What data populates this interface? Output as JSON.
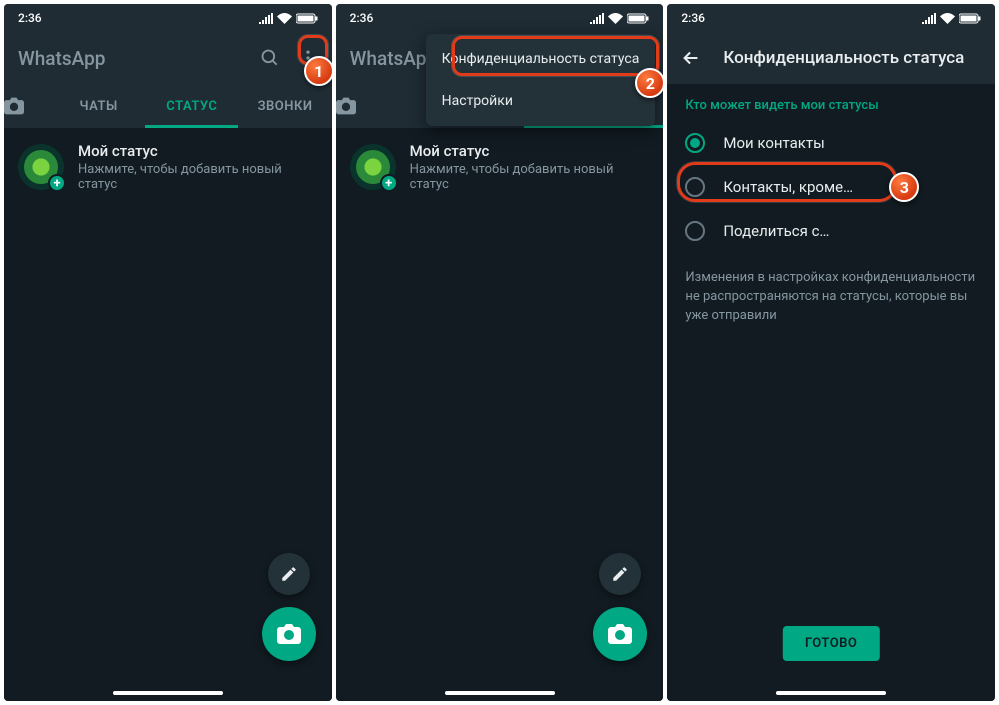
{
  "status_bar": {
    "time": "2:36"
  },
  "app": {
    "title": "WhatsApp",
    "tabs": {
      "chats": "ЧАТЫ",
      "status": "СТАТУС",
      "calls": "ЗВОНКИ"
    },
    "my_status": {
      "title": "Мой статус",
      "subtitle": "Нажмите, чтобы добавить новый статус"
    }
  },
  "menu": {
    "privacy": "Конфиденциальность статуса",
    "settings": "Настройки"
  },
  "privacy_screen": {
    "title": "Конфиденциальность статуса",
    "section": "Кто может видеть мои статусы",
    "options": {
      "contacts": "Мои контакты",
      "except": "Контакты, кроме…",
      "share": "Поделиться с…"
    },
    "hint": "Изменения в настройках конфиденциальности не распространяются на статусы, которые вы уже отправили",
    "done": "ГОТОВО"
  },
  "callouts": {
    "n1": "1",
    "n2": "2",
    "n3": "3"
  }
}
